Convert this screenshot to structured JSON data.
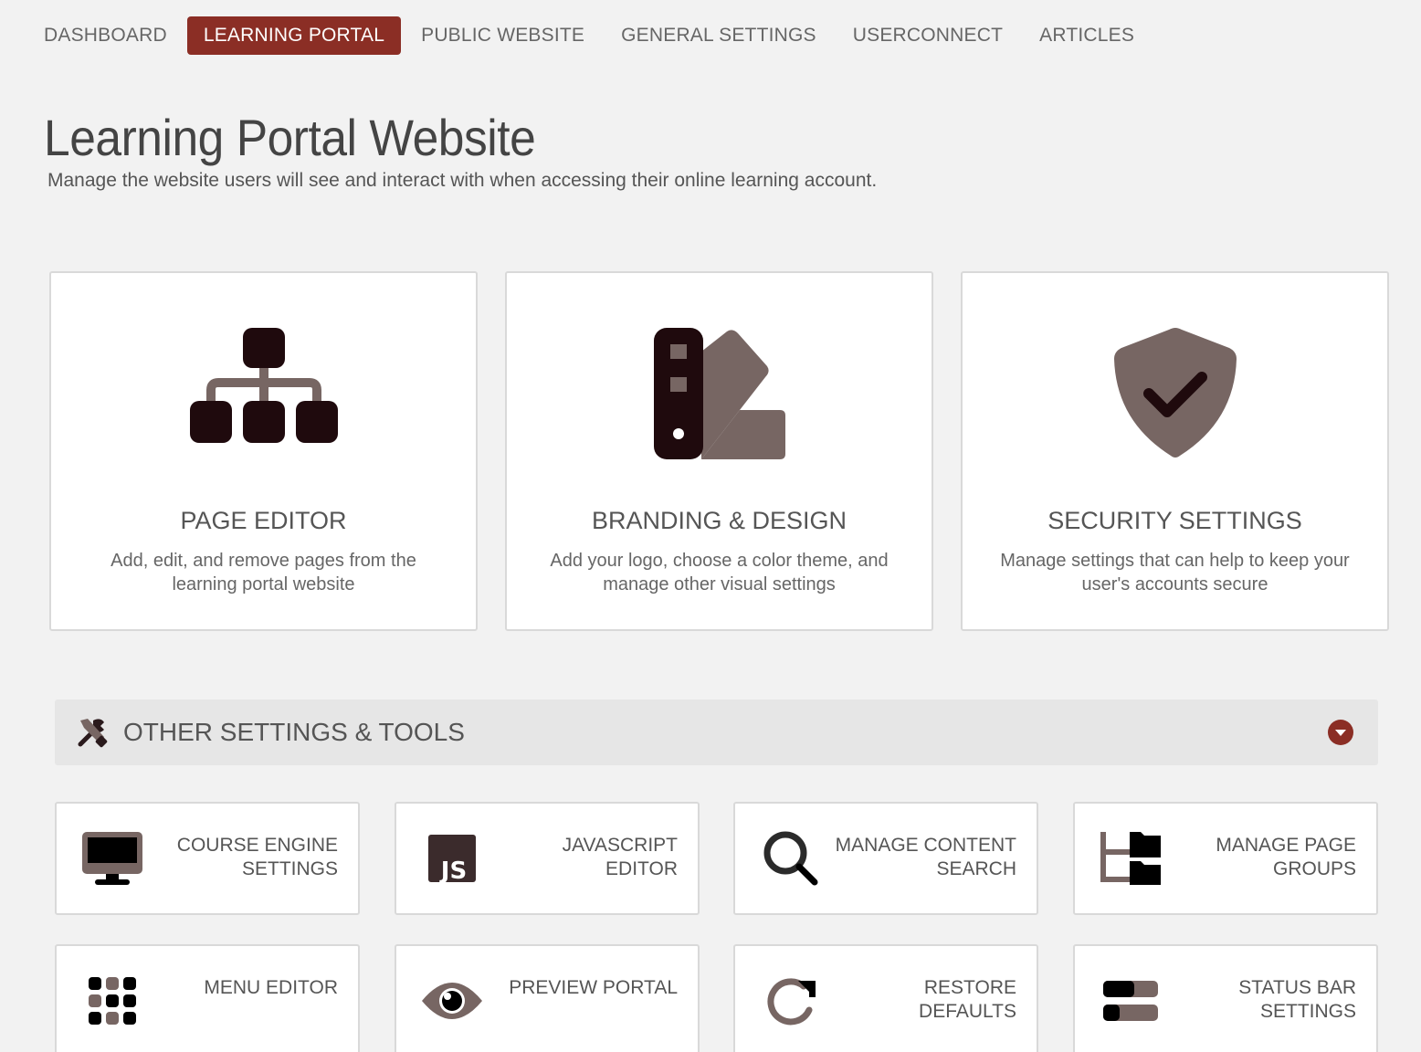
{
  "nav": {
    "tabs": [
      {
        "label": "DASHBOARD"
      },
      {
        "label": "LEARNING PORTAL"
      },
      {
        "label": "PUBLIC WEBSITE"
      },
      {
        "label": "GENERAL SETTINGS"
      },
      {
        "label": "USERCONNECT"
      },
      {
        "label": "ARTICLES"
      }
    ],
    "active_tab": "LEARNING PORTAL"
  },
  "header": {
    "title": "Learning Portal Website",
    "subtitle": "Manage the website users will see and interact with when accessing their online learning account."
  },
  "cards": [
    {
      "title": "PAGE EDITOR",
      "desc": "Add, edit, and remove pages from the learning portal website",
      "icon": "sitemap-icon"
    },
    {
      "title": "BRANDING & DESIGN",
      "desc": "Add your logo, choose a color theme, and manage other visual settings",
      "icon": "swatchbook-icon"
    },
    {
      "title": "SECURITY SETTINGS",
      "desc": "Manage settings that can help to keep your user's accounts secure",
      "icon": "shield-check-icon"
    }
  ],
  "other": {
    "label": "OTHER SETTINGS & TOOLS",
    "icon": "tools-icon",
    "toggle_icon": "chevron-down-icon"
  },
  "tiles": [
    {
      "label": "COURSE ENGINE SETTINGS",
      "icon": "desktop-icon"
    },
    {
      "label": "JAVASCRIPT EDITOR",
      "icon": "js-icon"
    },
    {
      "label": "MANAGE CONTENT SEARCH",
      "icon": "search-icon"
    },
    {
      "label": "MANAGE PAGE GROUPS",
      "icon": "folder-tree-icon"
    },
    {
      "label": "MENU EDITOR",
      "icon": "grid-icon"
    },
    {
      "label": "PREVIEW PORTAL",
      "icon": "eye-icon"
    },
    {
      "label": "RESTORE DEFAULTS",
      "icon": "redo-icon"
    },
    {
      "label": "STATUS BAR SETTINGS",
      "icon": "toggles-icon"
    }
  ],
  "colors": {
    "accent": "#8b2e25",
    "icon_dark": "#1f0a0d",
    "icon_muted": "#776663"
  }
}
